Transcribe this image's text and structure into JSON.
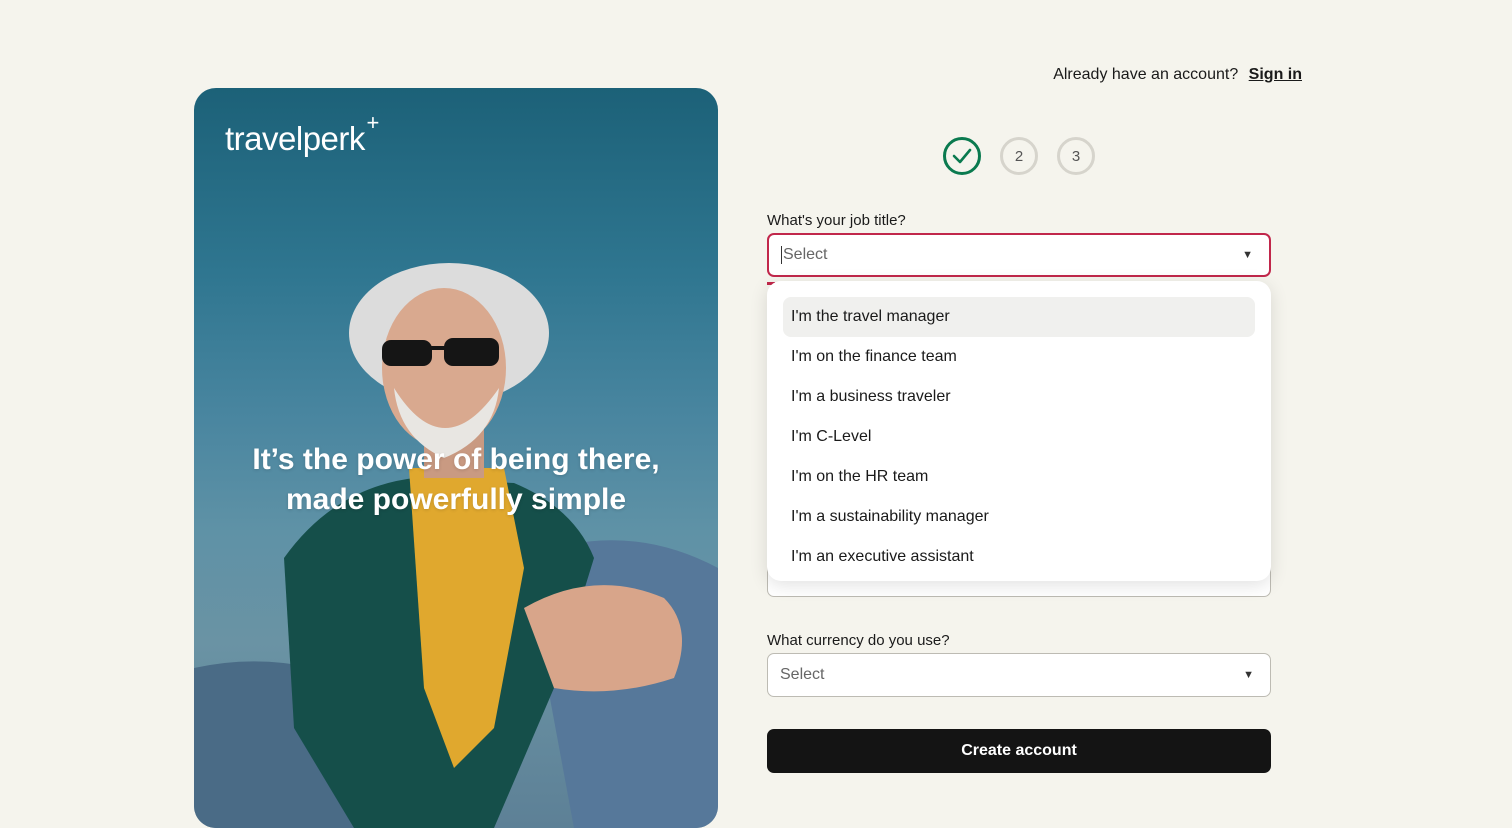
{
  "brand": {
    "logo_text": "travelperk",
    "logo_plus": "+"
  },
  "hero": {
    "headline_line1": "It’s the power of being there,",
    "headline_line2": "made powerfully simple"
  },
  "header": {
    "signin_prompt": "Already have an account?",
    "signin_link": "Sign in"
  },
  "stepper": {
    "steps": [
      {
        "label": "",
        "state": "done",
        "icon": "check-icon"
      },
      {
        "label": "2",
        "state": "pending"
      },
      {
        "label": "3",
        "state": "pending"
      }
    ]
  },
  "form": {
    "job_title": {
      "label": "What's your job title?",
      "placeholder": "Select",
      "options": [
        "I'm the travel manager",
        "I'm on the finance team",
        "I'm a business traveler",
        "I'm C-Level",
        "I'm on the HR team",
        "I'm a sustainability manager",
        "I'm an executive assistant"
      ]
    },
    "currency": {
      "label": "What currency do you use?",
      "placeholder": "Select"
    },
    "submit_label": "Create account"
  },
  "colors": {
    "background": "#f5f4ed",
    "accent_green": "#0a7a4f",
    "error_red": "#c1274b",
    "button_black": "#141414"
  }
}
